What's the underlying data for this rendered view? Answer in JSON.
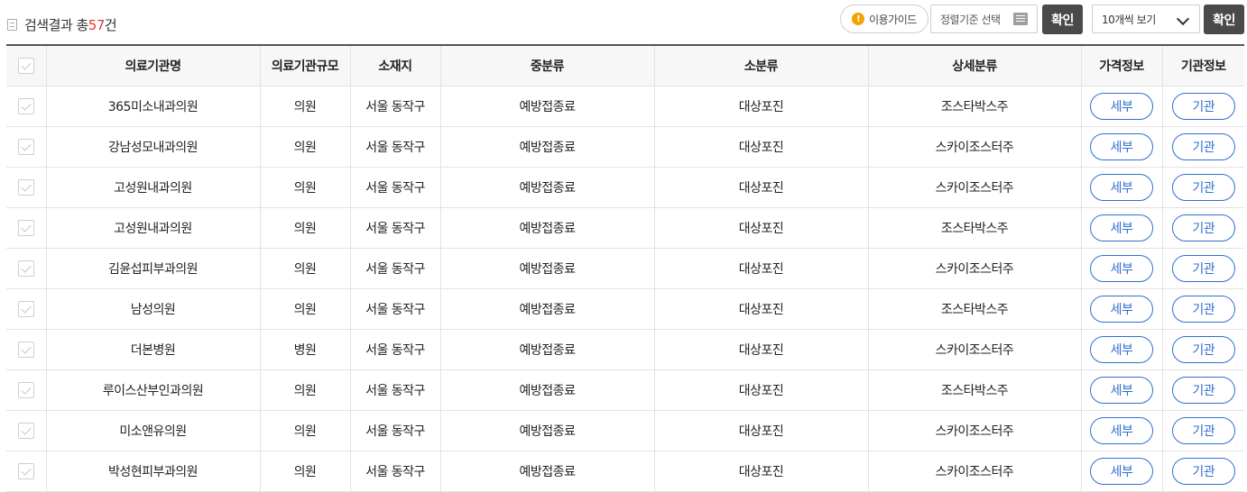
{
  "header": {
    "result_prefix": "검색결과 총",
    "result_count": "57",
    "result_suffix": "건",
    "guide_label": "이용가이드",
    "sort_placeholder": "정렬기준 선택",
    "confirm_label": "확인",
    "page_size_selected": "10개씩 보기",
    "confirm2_label": "확인"
  },
  "table": {
    "columns": [
      "의료기관명",
      "의료기관규모",
      "소재지",
      "중분류",
      "소분류",
      "상세분류",
      "가격정보",
      "기관정보"
    ],
    "price_button_label": "세부",
    "org_button_label": "기관",
    "rows": [
      {
        "name": "365미소내과의원",
        "scale": "의원",
        "location": "서울 동작구",
        "mid": "예방접종료",
        "sub": "대상포진",
        "detail": "조스타박스주"
      },
      {
        "name": "강남성모내과의원",
        "scale": "의원",
        "location": "서울 동작구",
        "mid": "예방접종료",
        "sub": "대상포진",
        "detail": "스카이조스터주"
      },
      {
        "name": "고성원내과의원",
        "scale": "의원",
        "location": "서울 동작구",
        "mid": "예방접종료",
        "sub": "대상포진",
        "detail": "스카이조스터주"
      },
      {
        "name": "고성원내과의원",
        "scale": "의원",
        "location": "서울 동작구",
        "mid": "예방접종료",
        "sub": "대상포진",
        "detail": "조스타박스주"
      },
      {
        "name": "김윤섭피부과의원",
        "scale": "의원",
        "location": "서울 동작구",
        "mid": "예방접종료",
        "sub": "대상포진",
        "detail": "스카이조스터주"
      },
      {
        "name": "남성의원",
        "scale": "의원",
        "location": "서울 동작구",
        "mid": "예방접종료",
        "sub": "대상포진",
        "detail": "조스타박스주"
      },
      {
        "name": "더본병원",
        "scale": "병원",
        "location": "서울 동작구",
        "mid": "예방접종료",
        "sub": "대상포진",
        "detail": "스카이조스터주"
      },
      {
        "name": "루이스산부인과의원",
        "scale": "의원",
        "location": "서울 동작구",
        "mid": "예방접종료",
        "sub": "대상포진",
        "detail": "조스타박스주"
      },
      {
        "name": "미소앤유의원",
        "scale": "의원",
        "location": "서울 동작구",
        "mid": "예방접종료",
        "sub": "대상포진",
        "detail": "스카이조스터주"
      },
      {
        "name": "박성현피부과의원",
        "scale": "의원",
        "location": "서울 동작구",
        "mid": "예방접종료",
        "sub": "대상포진",
        "detail": "스카이조스터주"
      }
    ]
  }
}
